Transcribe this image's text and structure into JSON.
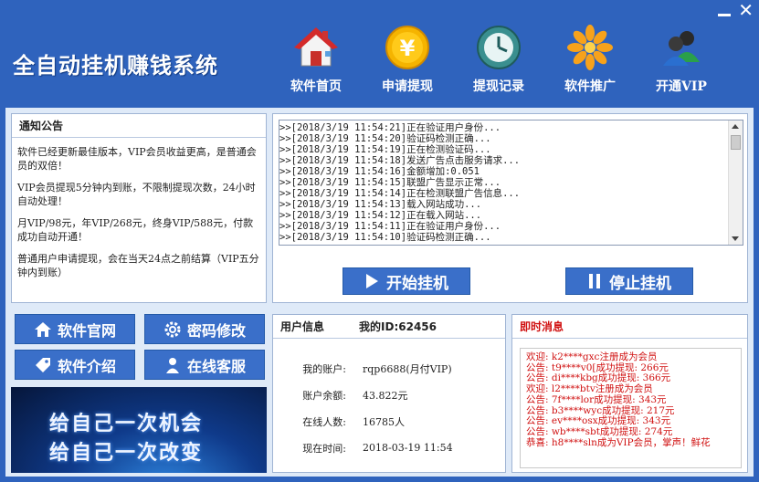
{
  "app": {
    "title": "全自动挂机赚钱系统"
  },
  "window": {
    "min_label": "",
    "close_label": "✕"
  },
  "nav": [
    {
      "label": "软件首页",
      "icon": "home-icon"
    },
    {
      "label": "申请提现",
      "icon": "yen-coin-icon"
    },
    {
      "label": "提现记录",
      "icon": "history-clock-icon"
    },
    {
      "label": "软件推广",
      "icon": "flower-icon"
    },
    {
      "label": "开通VIP",
      "icon": "users-icon"
    }
  ],
  "notice": {
    "title": "通知公告",
    "paragraphs": [
      "软件已经更新最佳版本，VIP会员收益更高，是普通会员的双倍！",
      "VIP会员提现5分钟内到账，不限制提现次数，24小时自动处理！",
      "月VIP/98元，年VIP/268元，终身VIP/588元，付款成功自动开通！",
      "普通用户申请提现，会在当天24点之前结算（VIP五分钟内到账）"
    ]
  },
  "log": {
    "lines": [
      ">>[2018/3/19 11:54:21]正在验证用户身份...",
      ">>[2018/3/19 11:54:20]验证码检测正确...",
      ">>[2018/3/19 11:54:19]正在检测验证码...",
      ">>[2018/3/19 11:54:18]发送广告点击服务请求...",
      ">>[2018/3/19 11:54:16]金额增加:0.051",
      ">>[2018/3/19 11:54:15]联盟广告显示正常...",
      ">>[2018/3/19 11:54:14]正在检测联盟广告信息...",
      ">>[2018/3/19 11:54:13]载入网站成功...",
      ">>[2018/3/19 11:54:12]正在载入网站...",
      ">>[2018/3/19 11:54:11]正在验证用户身份...",
      ">>[2018/3/19 11:54:10]验证码检测正确..."
    ],
    "start_label": "开始挂机",
    "stop_label": "停止挂机"
  },
  "side_buttons": {
    "website": "软件官网",
    "password": "密码修改",
    "intro": "软件介绍",
    "service": "在线客服"
  },
  "banner": {
    "line1": "给自己一次机会",
    "line2": "给自己一次改变"
  },
  "user_info": {
    "title": "用户信息",
    "id_label": "我的ID:62456",
    "rows": [
      {
        "key": "我的账户:",
        "value": "rqp6688(月付VIP)"
      },
      {
        "key": "账户余额:",
        "value": "43.822元"
      },
      {
        "key": "在线人数:",
        "value": "16785人"
      },
      {
        "key": "现在时间:",
        "value": "2018-03-19 11:54"
      }
    ]
  },
  "realtime": {
    "title": "即时消息",
    "messages": [
      "欢迎: k2****gxc注册成为会员",
      "公告: t9****v0[成功提现: 266元",
      "公告: di****kbg成功提现: 366元",
      "欢迎: l2****btv注册成为会员",
      "公告: 7f****lor成功提现: 343元",
      "公告: b3****wyc成功提现: 217元",
      "公告: ev****osx成功提现: 343元",
      "公告: wb****sbt成功提现: 274元",
      "恭喜: h8****sln成为VIP会员，掌声！鲜花"
    ]
  },
  "colors": {
    "bg": "#2f63bd",
    "button": "#3a6fc9",
    "alert": "#d01010"
  }
}
